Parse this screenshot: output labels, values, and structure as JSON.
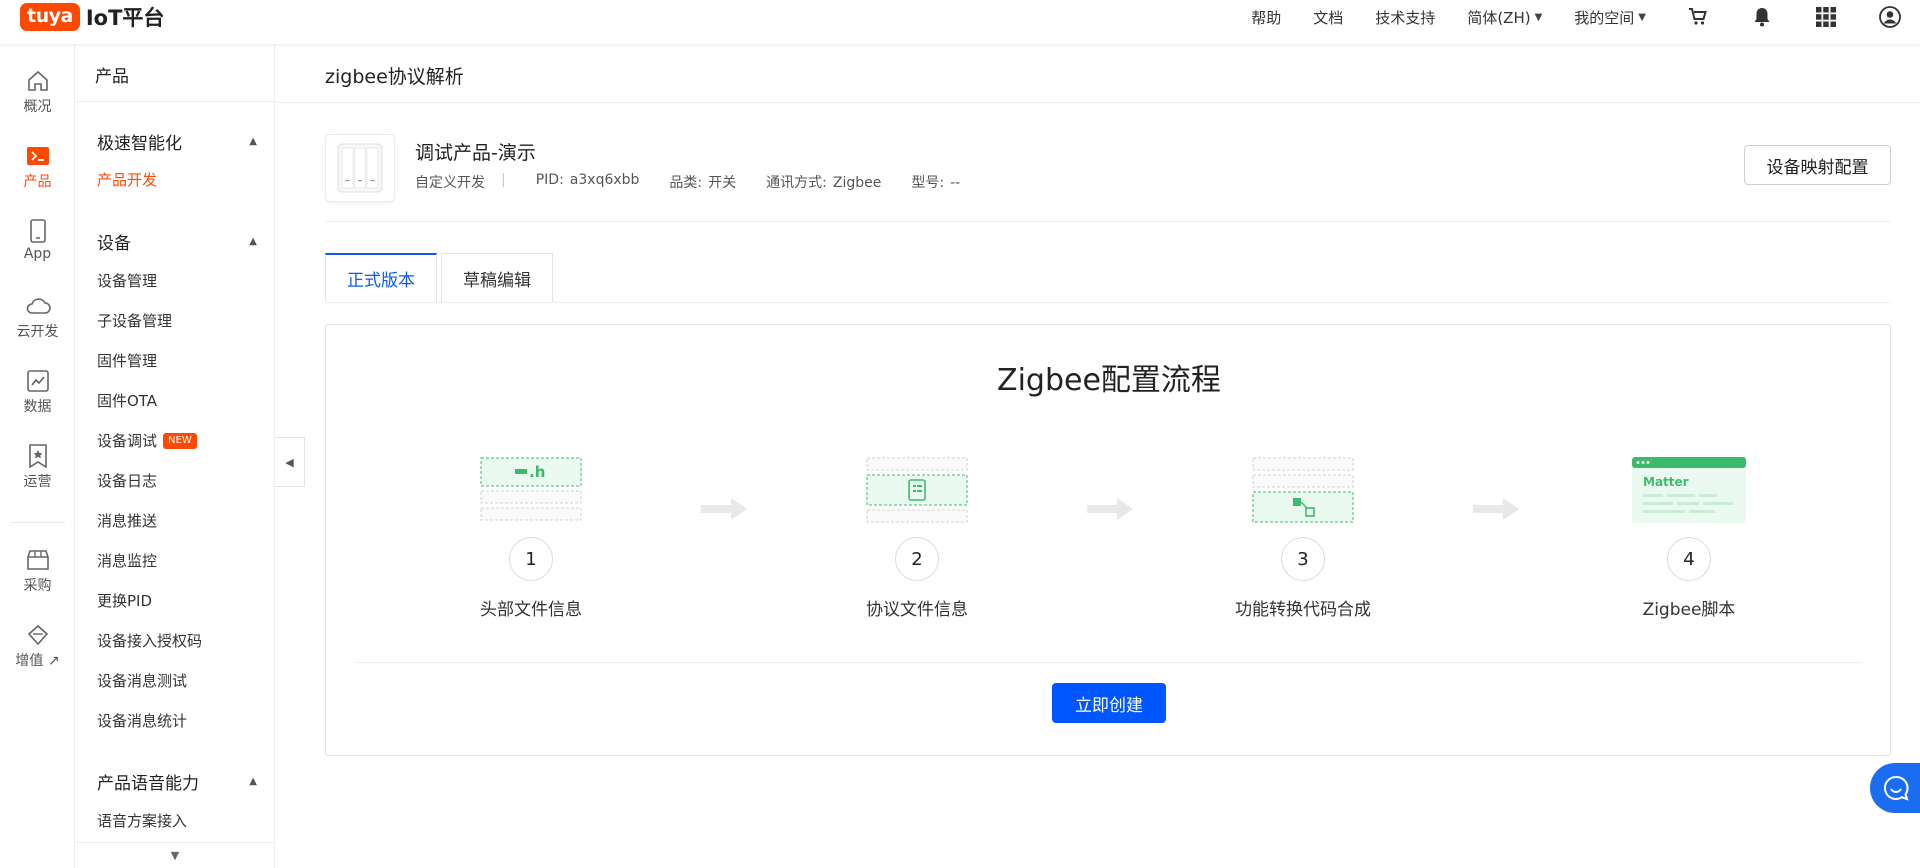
{
  "brand": {
    "badge": "tuya",
    "product": "IoT平台",
    "color": "#ff4800"
  },
  "topnav": {
    "help": "帮助",
    "docs": "文档",
    "support": "技术支持",
    "language": "简体(ZH)",
    "space": "我的空间",
    "icons": [
      "cart-icon",
      "bell-icon",
      "apps-grid-icon",
      "user-avatar-icon"
    ]
  },
  "rail": [
    {
      "label": "概况",
      "icon": "home-icon"
    },
    {
      "label": "产品",
      "icon": "terminal-icon"
    },
    {
      "label": "App",
      "icon": "phone-icon"
    },
    {
      "label": "云开发",
      "icon": "cloud-icon"
    },
    {
      "label": "数据",
      "icon": "chart-icon"
    },
    {
      "label": "运营",
      "icon": "bookmark-star-icon"
    },
    {
      "label": "采购",
      "icon": "store-icon"
    },
    {
      "label": "增值 ↗",
      "icon": "diamond-icon"
    }
  ],
  "menu": {
    "title": "产品",
    "group1": "极速智能化",
    "group1_items": [
      "产品开发"
    ],
    "group2": "设备",
    "group2_items": [
      "设备管理",
      "子设备管理",
      "固件管理",
      "固件OTA",
      "设备调试",
      "设备日志",
      "消息推送",
      "消息监控",
      "更换PID",
      "设备接入授权码",
      "设备消息测试",
      "设备消息统计"
    ],
    "new_badge": "NEW",
    "group3": "产品语音能力",
    "group3_items": [
      "语音方案接入"
    ]
  },
  "page": {
    "title": "zigbee协议解析",
    "product_name": "调试产品-演示",
    "meta": {
      "dev_type": "自定义开发",
      "pid_label": "PID:",
      "pid": "a3xq6xbb",
      "category_label": "品类:",
      "category": "开关",
      "comm_label": "通讯方式:",
      "comm": "Zigbee",
      "model_label": "型号:",
      "model": "--"
    },
    "map_button": "设备映射配置",
    "tabs": [
      "正式版本",
      "草稿编辑"
    ],
    "flow": {
      "title": "Zigbee配置流程",
      "steps": [
        {
          "num": "1",
          "label": "头部文件信息",
          "tag": ".h"
        },
        {
          "num": "2",
          "label": "协议文件信息"
        },
        {
          "num": "3",
          "label": "功能转换代码合成"
        },
        {
          "num": "4",
          "label": "Zigbee脚本",
          "tag": "Matter"
        }
      ],
      "create_button": "立即创建"
    }
  },
  "colors": {
    "accent": "#1059e8",
    "primary_button": "#0057ff",
    "active_nav": "#ff4800",
    "illus_green": "#3dbb6c"
  }
}
